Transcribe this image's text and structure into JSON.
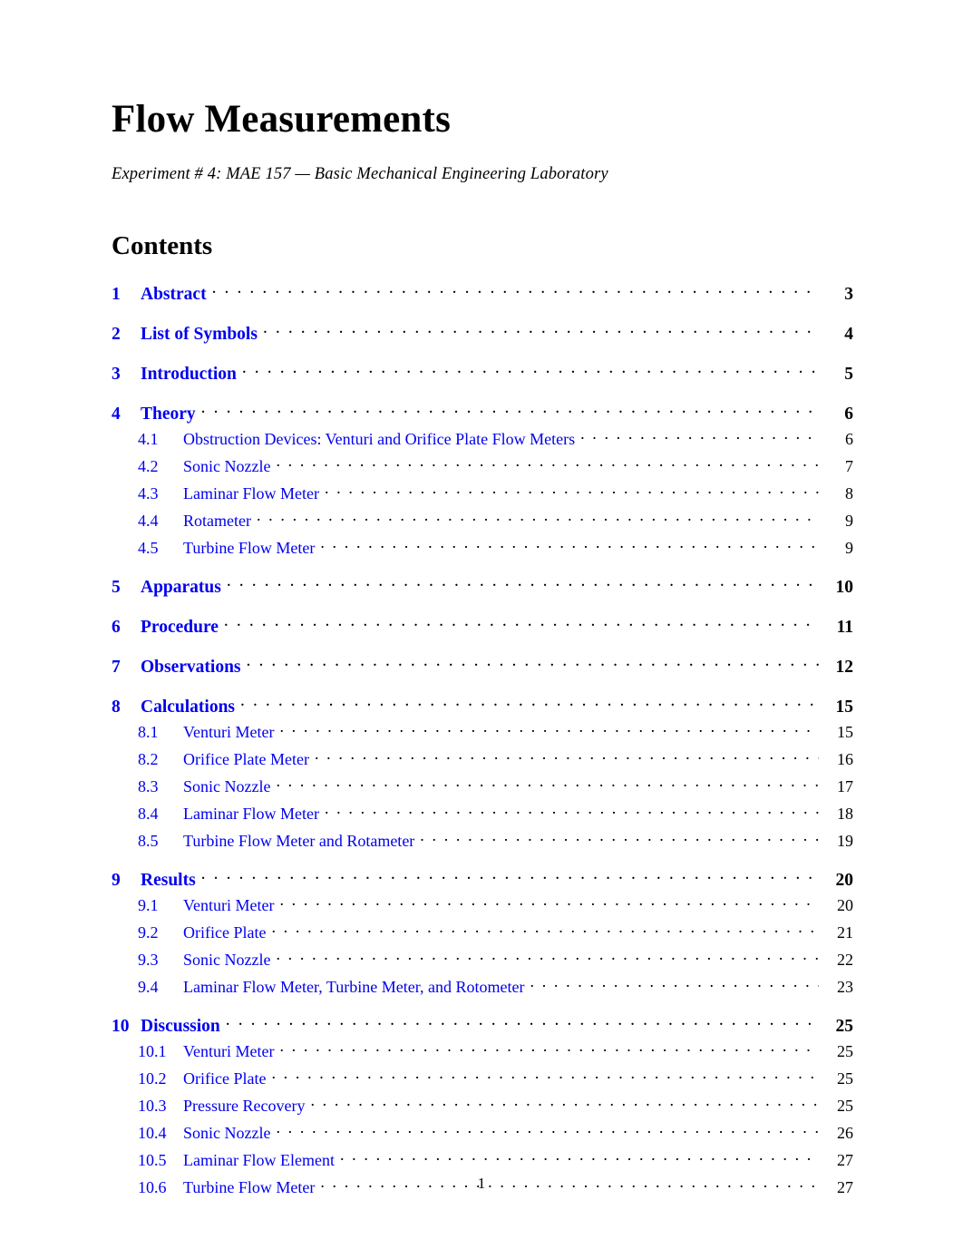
{
  "document": {
    "title": "Flow Measurements",
    "subtitle": "Experiment # 4: MAE 157 — Basic Mechanical Engineering Laboratory",
    "toc_heading": "Contents",
    "page_number": "1",
    "link_color": "#0000ee",
    "text_color": "#000000"
  },
  "toc": {
    "entries": [
      {
        "level": 1,
        "number": "1",
        "label": "Abstract",
        "page": "3"
      },
      {
        "level": 1,
        "number": "2",
        "label": "List of Symbols",
        "page": "4"
      },
      {
        "level": 1,
        "number": "3",
        "label": "Introduction",
        "page": "5"
      },
      {
        "level": 1,
        "number": "4",
        "label": "Theory",
        "page": "6"
      },
      {
        "level": 2,
        "number": "4.1",
        "label": "Obstruction Devices: Venturi and Orifice Plate Flow Meters",
        "page": "6"
      },
      {
        "level": 2,
        "number": "4.2",
        "label": "Sonic Nozzle",
        "page": "7"
      },
      {
        "level": 2,
        "number": "4.3",
        "label": "Laminar Flow Meter",
        "page": "8"
      },
      {
        "level": 2,
        "number": "4.4",
        "label": "Rotameter",
        "page": "9"
      },
      {
        "level": 2,
        "number": "4.5",
        "label": "Turbine Flow Meter",
        "page": "9"
      },
      {
        "level": 1,
        "number": "5",
        "label": "Apparatus",
        "page": "10"
      },
      {
        "level": 1,
        "number": "6",
        "label": "Procedure",
        "page": "11"
      },
      {
        "level": 1,
        "number": "7",
        "label": "Observations",
        "page": "12"
      },
      {
        "level": 1,
        "number": "8",
        "label": "Calculations",
        "page": "15"
      },
      {
        "level": 2,
        "number": "8.1",
        "label": "Venturi Meter",
        "page": "15"
      },
      {
        "level": 2,
        "number": "8.2",
        "label": "Orifice Plate Meter",
        "page": "16"
      },
      {
        "level": 2,
        "number": "8.3",
        "label": "Sonic Nozzle",
        "page": "17"
      },
      {
        "level": 2,
        "number": "8.4",
        "label": "Laminar Flow Meter",
        "page": "18"
      },
      {
        "level": 2,
        "number": "8.5",
        "label": "Turbine Flow Meter and Rotameter",
        "page": "19"
      },
      {
        "level": 1,
        "number": "9",
        "label": "Results",
        "page": "20"
      },
      {
        "level": 2,
        "number": "9.1",
        "label": "Venturi Meter",
        "page": "20"
      },
      {
        "level": 2,
        "number": "9.2",
        "label": "Orifice Plate",
        "page": "21"
      },
      {
        "level": 2,
        "number": "9.3",
        "label": "Sonic Nozzle",
        "page": "22"
      },
      {
        "level": 2,
        "number": "9.4",
        "label": "Laminar Flow Meter, Turbine Meter, and Rotometer",
        "page": "23"
      },
      {
        "level": 1,
        "number": "10",
        "label": "Discussion",
        "page": "25"
      },
      {
        "level": 2,
        "number": "10.1",
        "label": "Venturi Meter",
        "page": "25"
      },
      {
        "level": 2,
        "number": "10.2",
        "label": "Orifice Plate",
        "page": "25"
      },
      {
        "level": 2,
        "number": "10.3",
        "label": "Pressure Recovery",
        "page": "25"
      },
      {
        "level": 2,
        "number": "10.4",
        "label": "Sonic Nozzle",
        "page": "26"
      },
      {
        "level": 2,
        "number": "10.5",
        "label": "Laminar Flow Element",
        "page": "27"
      },
      {
        "level": 2,
        "number": "10.6",
        "label": "Turbine Flow Meter",
        "page": "27"
      }
    ]
  }
}
